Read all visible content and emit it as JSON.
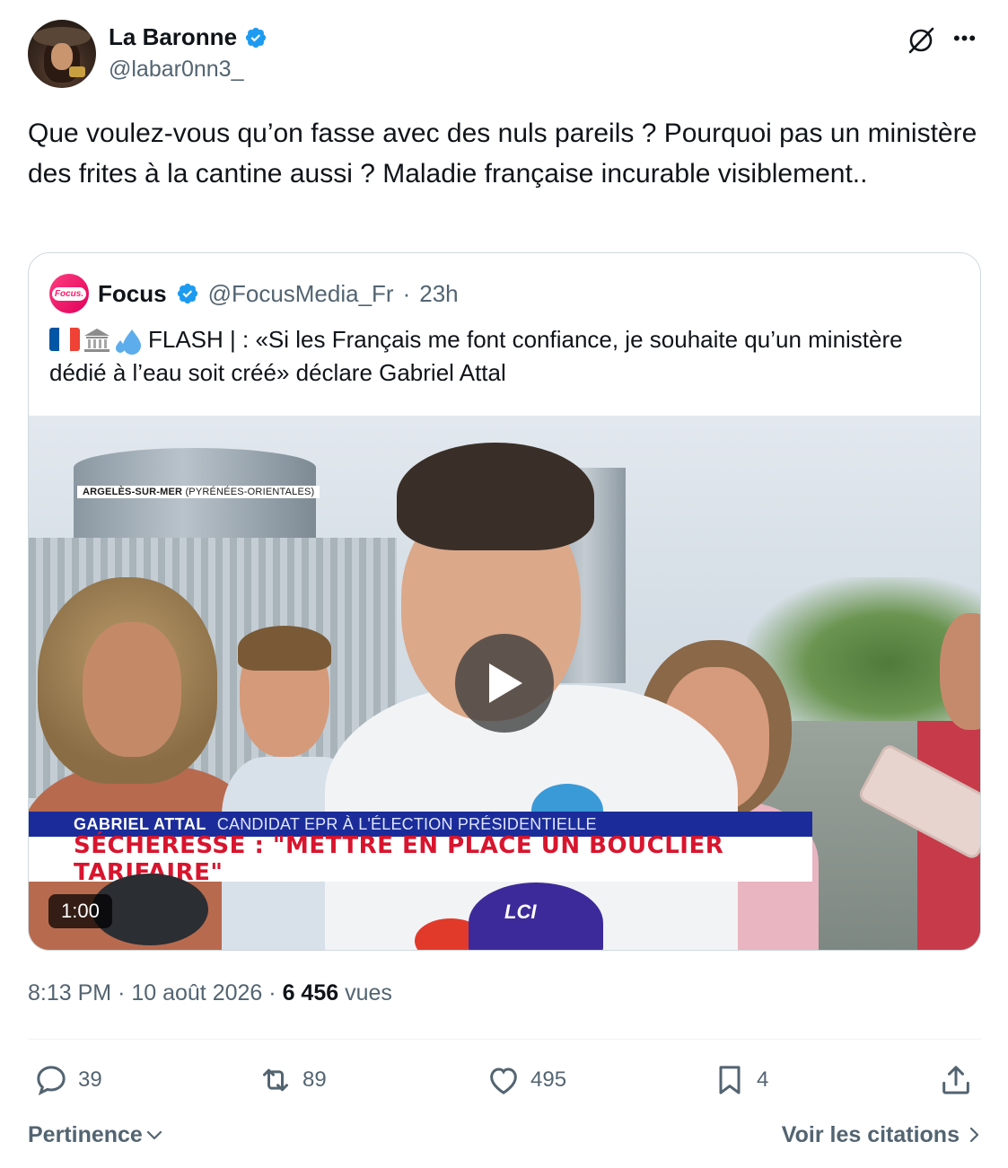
{
  "author": {
    "display_name": "La Baronne",
    "handle": "@labar0nn3_"
  },
  "tweet": {
    "text": "Que voulez-vous qu’on fasse avec des nuls pareils ? Pourquoi pas un ministère des frites à la cantine aussi ? Maladie française incurable visiblement.."
  },
  "quoted": {
    "name": "Focus",
    "avatar_text": "Focus.",
    "handle": "@FocusMedia_Fr",
    "separator": "·",
    "time": "23h",
    "text": "FLASH | : «Si les Français me font confiance, je souhaite qu’un ministère dédié à l’eau soit créé» déclare Gabriel Attal",
    "video": {
      "location": "ARGELÈS-SUR-MER",
      "location_sub": "(PYRÉNÉES-ORIENTALES)",
      "banner_name": "GABRIEL ATTAL",
      "banner_role": "CANDIDAT EPR À L'ÉLECTION PRÉSIDENTIELLE",
      "headline": "SÉCHERESSE : \"METTRE EN PLACE UN BOUCLIER TARIFAIRE\"",
      "mic_label": "LCI",
      "duration": "1:00"
    }
  },
  "meta": {
    "time": "8:13 PM",
    "separator": "·",
    "date": "10 août 2026",
    "views_count": "6 456",
    "views_label": "vues"
  },
  "actions": {
    "replies": "39",
    "reposts": "89",
    "likes": "495",
    "bookmarks": "4"
  },
  "footer": {
    "sort_label": "Pertinence",
    "quotes_label": "Voir les citations"
  },
  "colors": {
    "verified_blue": "#1d9bf0",
    "muted_text": "#536471",
    "banner_blue": "#1b2c9a",
    "headline_red": "#d8152e"
  }
}
